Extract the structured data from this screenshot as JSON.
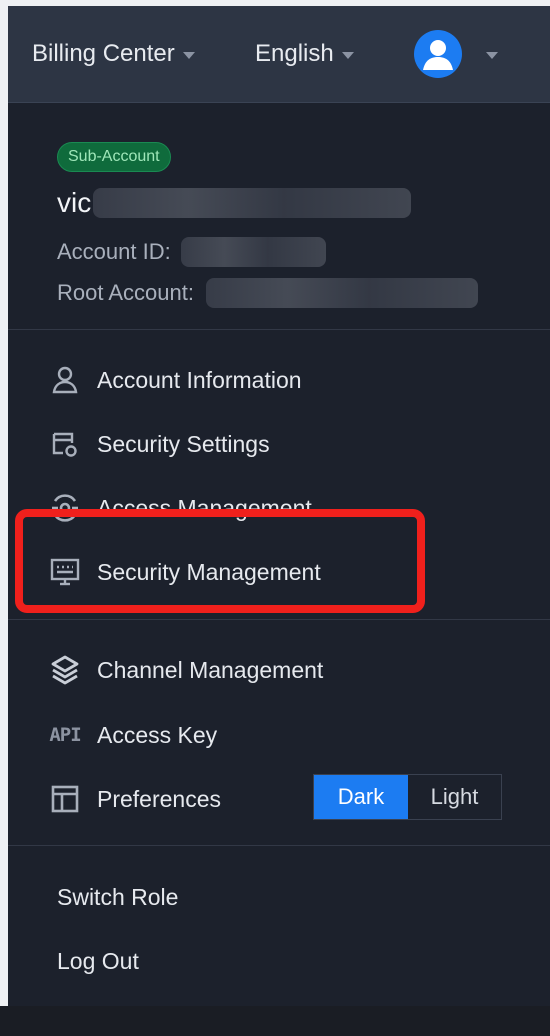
{
  "topbar": {
    "billing_label": "Billing Center",
    "language_label": "English",
    "avatar_icon": "user-avatar-icon"
  },
  "account": {
    "badge": "Sub-Account",
    "username_visible": "vic",
    "account_id_label": "Account ID:",
    "root_account_label": "Root Account:"
  },
  "menu": {
    "items": [
      {
        "label": "Account Information",
        "icon": "user-icon"
      },
      {
        "label": "Security Settings",
        "icon": "shield-gear-icon"
      },
      {
        "label": "Access Management",
        "icon": "access-icon"
      },
      {
        "label": "Security Management",
        "icon": "monitor-icon"
      },
      {
        "label": "Channel Management",
        "icon": "layers-icon"
      },
      {
        "label": "Access Key",
        "icon": "api-icon",
        "icon_text": "API"
      },
      {
        "label": "Preferences",
        "icon": "layout-icon"
      }
    ]
  },
  "theme_toggle": {
    "options": [
      "Dark",
      "Light"
    ],
    "selected": "Dark"
  },
  "footer_actions": {
    "switch_role": "Switch Role",
    "log_out": "Log Out"
  },
  "colors": {
    "panel_bg": "#1c212c",
    "topbar_bg": "#2d3544",
    "accent": "#1c7cf2",
    "highlight": "#f0201c",
    "badge_bg": "#0f6b3c"
  }
}
